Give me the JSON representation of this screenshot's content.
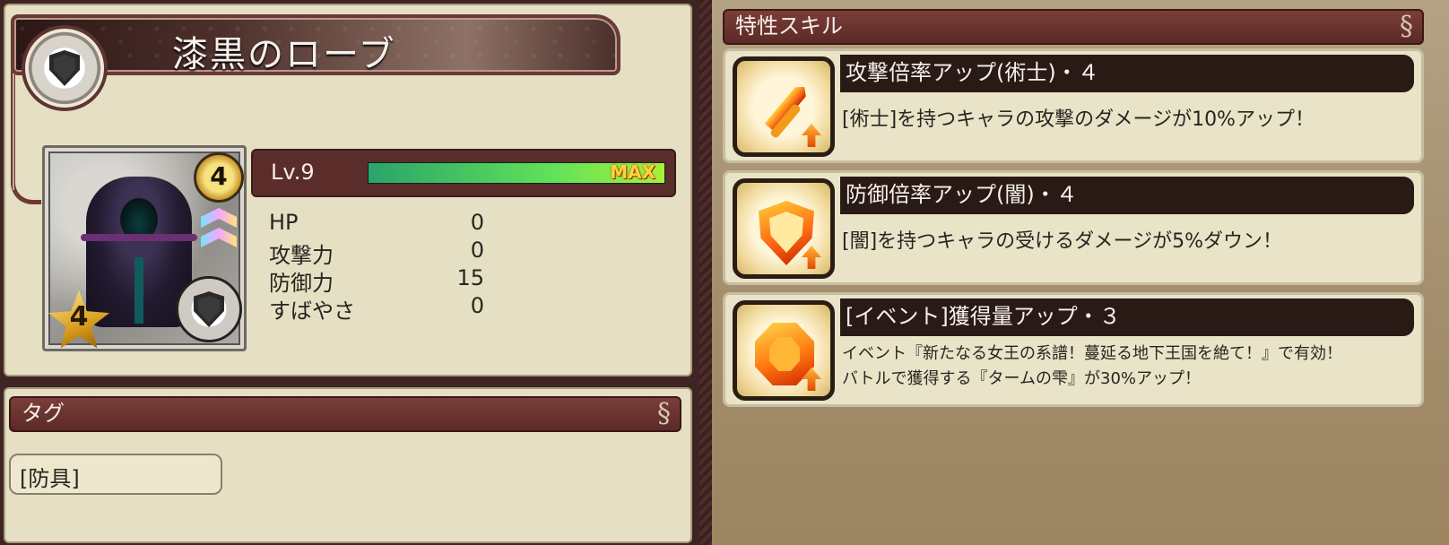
{
  "item": {
    "name": "漆黒のローブ",
    "rarity": "4",
    "stars": "4",
    "level_label": "Lv.9",
    "exp_max_label": "MAX",
    "exp_fill_fraction": 1.0,
    "category_icon": "shield-icon",
    "stats": [
      {
        "label": "HP",
        "value": "0"
      },
      {
        "label": "攻撃力",
        "value": "0"
      },
      {
        "label": "防御力",
        "value": "15"
      },
      {
        "label": "すばやさ",
        "value": "0"
      }
    ]
  },
  "tags": {
    "header": "タグ",
    "items": [
      "[防具]"
    ]
  },
  "skills": {
    "header": "特性スキル",
    "items": [
      {
        "title": "攻撃倍率アップ(術士)・４",
        "description": "[術士]を持つキャラの攻撃のダメージが10%アップ！",
        "icon": "sword-up-icon"
      },
      {
        "title": "防御倍率アップ(闇)・４",
        "description": "[闇]を持つキャラの受けるダメージが5%ダウン！",
        "icon": "shield-up-icon"
      },
      {
        "title": "[イベント]獲得量アップ・３",
        "description_lines": [
          "イベント『新たなる女王の系譜！蔓延る地下王国を絶て！』で有効！",
          "バトルで獲得する『タームの雫』が30%アップ！"
        ],
        "icon": "gem-up-icon"
      }
    ]
  },
  "colors": {
    "panel": "#e5e0c3",
    "header": "#5b2a27",
    "skill_title_bar": "#2a1a16",
    "exp_bar": "#5ee05a",
    "max_text": "#ffd23c"
  }
}
